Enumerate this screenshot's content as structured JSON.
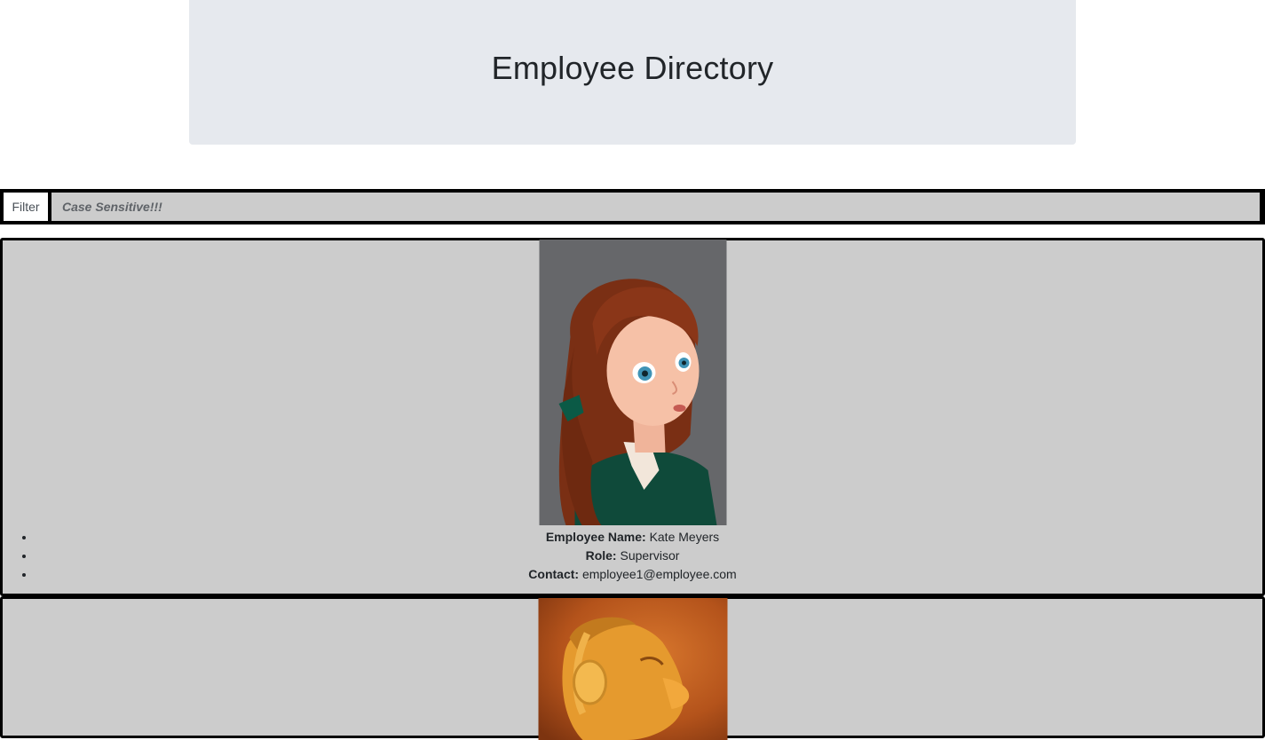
{
  "header": {
    "title": "Employee Directory"
  },
  "filter": {
    "label": "Filter",
    "placeholder": "Case Sensitive!!!",
    "value": ""
  },
  "employees": [
    {
      "photo_icon": "employee-portrait-red-haired-woman",
      "name_label": "Employee Name:",
      "name": "Kate Meyers",
      "role_label": "Role:",
      "role": "Supervisor",
      "contact_label": "Contact:",
      "contact": "employee1@employee.com"
    },
    {
      "photo_icon": "employee-portrait-orange-character-headphones"
    }
  ],
  "colors": {
    "jumbotron_bg": "#e6e9ee",
    "card_bg": "#cccccc",
    "border": "#000000",
    "text": "#212529"
  }
}
